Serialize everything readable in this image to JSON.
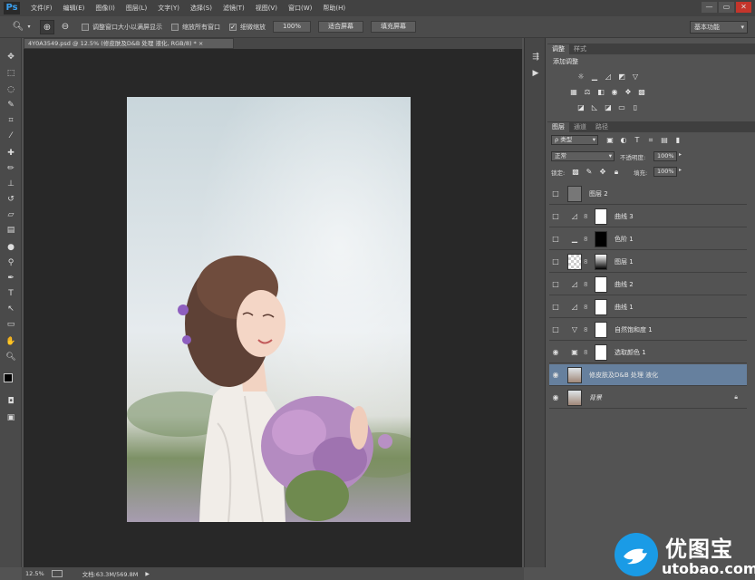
{
  "app": {
    "logo": "Ps"
  },
  "menubar": {
    "items": [
      "文件(F)",
      "编辑(E)",
      "图像(I)",
      "图层(L)",
      "文字(Y)",
      "选择(S)",
      "滤镜(T)",
      "视图(V)",
      "窗口(W)",
      "帮助(H)"
    ]
  },
  "window_controls": [
    "—",
    "▭",
    "✕"
  ],
  "options": {
    "resize_windows": "调整窗口大小以满屏显示",
    "zoom_all": "缩放所有窗口",
    "scrubby_zoom": "细微缩放",
    "btn_100": "100%",
    "btn_fit": "适合屏幕",
    "btn_fill": "填充屏幕",
    "workspace": "基本功能"
  },
  "document": {
    "tab_title": "4Y0A3549.psd @ 12.5% (修皮肤及D&B 处理 液化, RGB/8) *",
    "close": "×"
  },
  "panels": {
    "adjustments_tab": "调整",
    "styles_tab": "样式",
    "add_adjustment": "添加调整",
    "layers_tab": "图层",
    "channels_tab": "通道",
    "paths_tab": "路径",
    "filter_kind": "ρ 类型",
    "blend_mode": "正常",
    "opacity_label": "不透明度:",
    "opacity_value": "100%",
    "lock_label": "锁定:",
    "fill_label": "填充:",
    "fill_value": "100%"
  },
  "layers": [
    {
      "name": "图层 2",
      "kind": "fill-gray",
      "visible": false
    },
    {
      "name": "曲线 3",
      "kind": "curves",
      "visible": false
    },
    {
      "name": "色阶 1",
      "kind": "levels",
      "visible": false
    },
    {
      "name": "图层 1",
      "kind": "gradient",
      "visible": false
    },
    {
      "name": "曲线 2",
      "kind": "curves",
      "visible": false
    },
    {
      "name": "曲线 1",
      "kind": "curves",
      "visible": false
    },
    {
      "name": "自然饱和度 1",
      "kind": "vibrance",
      "visible": false
    },
    {
      "name": "选取颜色 1",
      "kind": "selective",
      "visible": true
    },
    {
      "name": "修皮肤及D&B 处理 液化",
      "kind": "photo",
      "visible": true,
      "selected": true
    },
    {
      "name": "背景",
      "kind": "photo",
      "visible": true,
      "locked": true
    }
  ],
  "status": {
    "zoom": "12.5%",
    "doc_size": "文档:63.3M/569.8M"
  },
  "watermark": {
    "cn": "优图宝",
    "url": "utobao.com"
  },
  "colors": {
    "accent_selected": "#66809e",
    "canvas_bg": "#282828",
    "ui_bg": "#535353"
  }
}
